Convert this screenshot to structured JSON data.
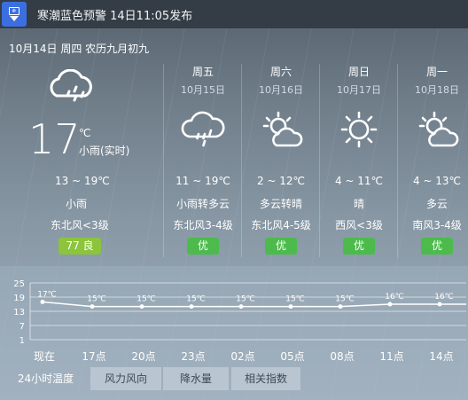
{
  "alert": {
    "icon": "warning-badge-icon",
    "text": "寒潮蓝色预警 14日11:05发布",
    "color": "#3b6fe0"
  },
  "date_line": "10月14日 周四 农历九月初九",
  "today": {
    "icon": "cloud-rain-icon",
    "temp": "17",
    "unit": "℃",
    "weather_now": "小雨(实时)",
    "range": "13 ~ 19℃",
    "condition": "小雨",
    "wind": "东北风<3级",
    "aqi": "77 良",
    "aqi_color": "#8cc43c"
  },
  "forecast": [
    {
      "weekday": "周五",
      "date": "10月15日",
      "icon": "cloud-rain-icon",
      "range": "11 ~ 19℃",
      "condition": "小雨转多云",
      "wind": "东北风3-4级",
      "aqi": "优"
    },
    {
      "weekday": "周六",
      "date": "10月16日",
      "icon": "partly-cloudy-icon",
      "range": "2 ~ 12℃",
      "condition": "多云转晴",
      "wind": "东北风4-5级",
      "aqi": "优"
    },
    {
      "weekday": "周日",
      "date": "10月17日",
      "icon": "sun-icon",
      "range": "4 ~ 11℃",
      "condition": "晴",
      "wind": "西风<3级",
      "aqi": "优"
    },
    {
      "weekday": "周一",
      "date": "10月18日",
      "icon": "partly-cloudy-icon",
      "range": "4 ~ 13℃",
      "condition": "多云",
      "wind": "南风3-4级",
      "aqi": "优"
    }
  ],
  "chart_data": {
    "type": "line",
    "categories": [
      "现在",
      "17点",
      "20点",
      "23点",
      "02点",
      "05点",
      "08点",
      "11点",
      "14点"
    ],
    "series": [
      {
        "values": [
          17,
          15,
          15,
          15,
          15,
          15,
          15,
          16,
          16
        ]
      }
    ],
    "value_labels": [
      "17℃",
      "15℃",
      "15℃",
      "15℃",
      "15℃",
      "15℃",
      "15℃",
      "16℃",
      "16℃"
    ],
    "yticks": [
      "25",
      "19",
      "13",
      "7",
      "1"
    ],
    "ylim": [
      1,
      25
    ],
    "grid": true
  },
  "tabs": [
    "24小时温度",
    "风力风向",
    "降水量",
    "相关指数"
  ]
}
